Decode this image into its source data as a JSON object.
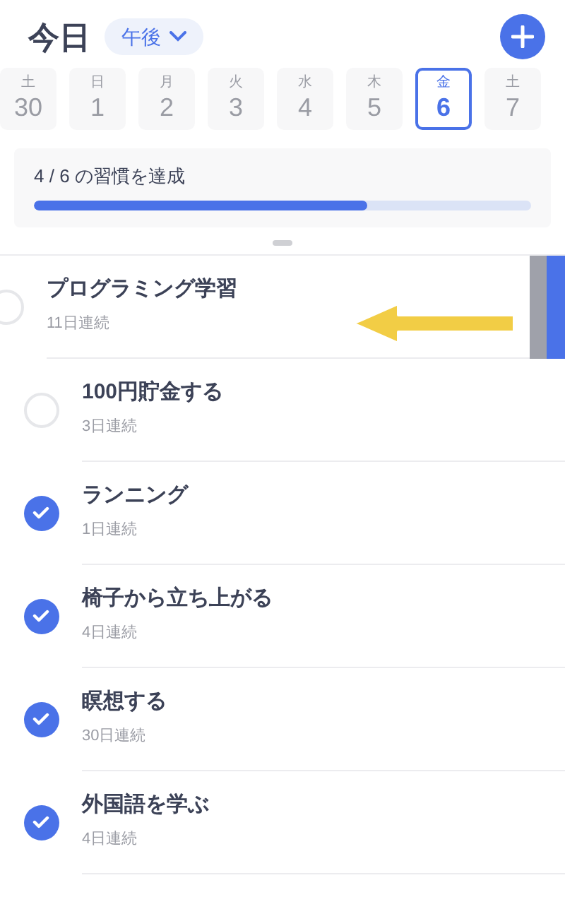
{
  "header": {
    "title": "今日",
    "period": "午後"
  },
  "days": [
    {
      "weekday": "土",
      "date": "30",
      "selected": false
    },
    {
      "weekday": "日",
      "date": "1",
      "selected": false
    },
    {
      "weekday": "月",
      "date": "2",
      "selected": false
    },
    {
      "weekday": "火",
      "date": "3",
      "selected": false
    },
    {
      "weekday": "水",
      "date": "4",
      "selected": false
    },
    {
      "weekday": "木",
      "date": "5",
      "selected": false
    },
    {
      "weekday": "金",
      "date": "6",
      "selected": true
    },
    {
      "weekday": "土",
      "date": "7",
      "selected": false
    }
  ],
  "progress": {
    "label": "4 / 6 の習慣を達成",
    "level": 0.67
  },
  "habits": [
    {
      "name": "プログラミング学習",
      "streak": "11日連続",
      "checked": false,
      "swiped": true
    },
    {
      "name": "100円貯金する",
      "streak": "3日連続",
      "checked": false,
      "swiped": false
    },
    {
      "name": "ランニング",
      "streak": "1日連続",
      "checked": true,
      "swiped": false
    },
    {
      "name": "椅子から立ち上がる",
      "streak": "4日連続",
      "checked": true,
      "swiped": false
    },
    {
      "name": "瞑想する",
      "streak": "30日連続",
      "checked": true,
      "swiped": false
    },
    {
      "name": "外国語を学ぶ",
      "streak": "4日連続",
      "checked": true,
      "swiped": false
    }
  ]
}
